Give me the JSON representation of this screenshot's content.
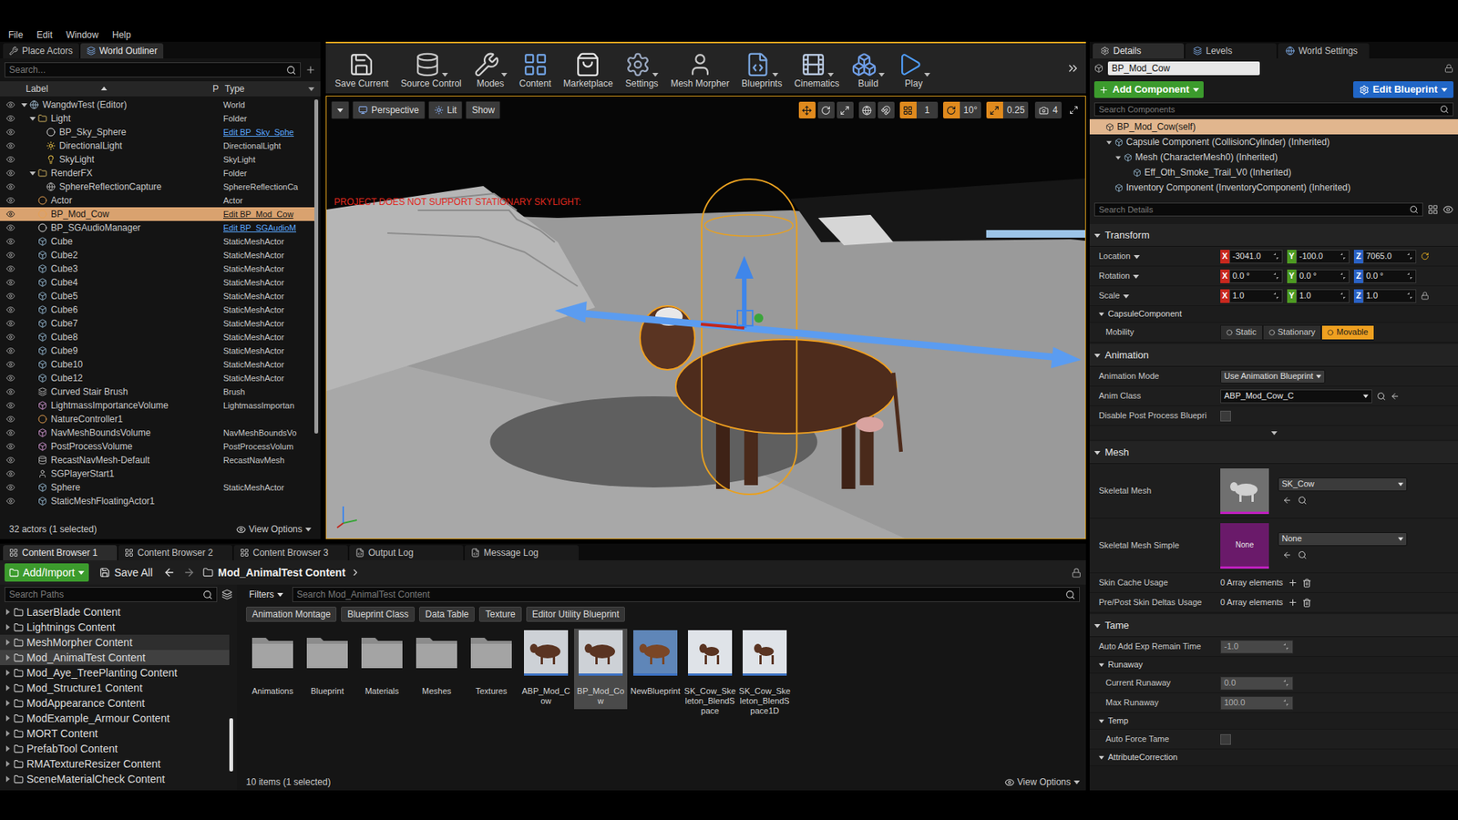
{
  "menu": [
    "File",
    "Edit",
    "Window",
    "Help"
  ],
  "outliner": {
    "tabs": [
      {
        "label": "Place Actors",
        "selected": false
      },
      {
        "label": "World Outliner",
        "selected": true
      }
    ],
    "search_placeholder": "Search...",
    "columns": {
      "label": "Label",
      "pinned": "P",
      "type": "Type"
    },
    "rows": [
      {
        "label": "WangdwTest (Editor)",
        "type": "World",
        "link": false,
        "kind": "world",
        "indent": 0,
        "expanded": true,
        "selected": false
      },
      {
        "label": "Light",
        "type": "Folder",
        "link": false,
        "kind": "folder",
        "indent": 1,
        "expanded": true,
        "selected": false
      },
      {
        "label": "BP_Sky_Sphere",
        "type": "Edit BP_Sky_Sphe",
        "link": true,
        "kind": "sky",
        "indent": 2,
        "expanded": false,
        "selected": false
      },
      {
        "label": "DirectionalLight",
        "type": "DirectionalLight",
        "link": false,
        "kind": "light",
        "indent": 2,
        "expanded": false,
        "selected": false
      },
      {
        "label": "SkyLight",
        "type": "SkyLight",
        "link": false,
        "kind": "skylight",
        "indent": 2,
        "expanded": false,
        "selected": false
      },
      {
        "label": "RenderFX",
        "type": "Folder",
        "link": false,
        "kind": "folder",
        "indent": 1,
        "expanded": true,
        "selected": false
      },
      {
        "label": "SphereReflectionCapture",
        "type": "SphereReflectionCa",
        "link": false,
        "kind": "reflection",
        "indent": 2,
        "expanded": false,
        "selected": false
      },
      {
        "label": "Actor",
        "type": "Actor",
        "link": false,
        "kind": "actor",
        "indent": 1,
        "expanded": false,
        "selected": false
      },
      {
        "label": "BP_Mod_Cow",
        "type": "Edit BP_Mod_Cow",
        "link": true,
        "kind": "actor",
        "indent": 1,
        "expanded": false,
        "selected": true
      },
      {
        "label": "BP_SGAudioManager",
        "type": "Edit BP_SGAudioM",
        "link": true,
        "kind": "sky",
        "indent": 1,
        "expanded": false,
        "selected": false
      },
      {
        "label": "Cube",
        "type": "StaticMeshActor",
        "link": false,
        "kind": "mesh",
        "indent": 1,
        "expanded": false,
        "selected": false
      },
      {
        "label": "Cube2",
        "type": "StaticMeshActor",
        "link": false,
        "kind": "mesh",
        "indent": 1,
        "expanded": false,
        "selected": false
      },
      {
        "label": "Cube3",
        "type": "StaticMeshActor",
        "link": false,
        "kind": "mesh",
        "indent": 1,
        "expanded": false,
        "selected": false
      },
      {
        "label": "Cube4",
        "type": "StaticMeshActor",
        "link": false,
        "kind": "mesh",
        "indent": 1,
        "expanded": false,
        "selected": false
      },
      {
        "label": "Cube5",
        "type": "StaticMeshActor",
        "link": false,
        "kind": "mesh",
        "indent": 1,
        "expanded": false,
        "selected": false
      },
      {
        "label": "Cube6",
        "type": "StaticMeshActor",
        "link": false,
        "kind": "mesh",
        "indent": 1,
        "expanded": false,
        "selected": false
      },
      {
        "label": "Cube7",
        "type": "StaticMeshActor",
        "link": false,
        "kind": "mesh",
        "indent": 1,
        "expanded": false,
        "selected": false
      },
      {
        "label": "Cube8",
        "type": "StaticMeshActor",
        "link": false,
        "kind": "mesh",
        "indent": 1,
        "expanded": false,
        "selected": false
      },
      {
        "label": "Cube9",
        "type": "StaticMeshActor",
        "link": false,
        "kind": "mesh",
        "indent": 1,
        "expanded": false,
        "selected": false
      },
      {
        "label": "Cube10",
        "type": "StaticMeshActor",
        "link": false,
        "kind": "mesh",
        "indent": 1,
        "expanded": false,
        "selected": false
      },
      {
        "label": "Cube12",
        "type": "StaticMeshActor",
        "link": false,
        "kind": "mesh",
        "indent": 1,
        "expanded": false,
        "selected": false
      },
      {
        "label": "Curved Stair Brush",
        "type": "Brush",
        "link": false,
        "kind": "brush",
        "indent": 1,
        "expanded": false,
        "selected": false
      },
      {
        "label": "LightmassImportanceVolume",
        "type": "LightmassImportan",
        "link": false,
        "kind": "volume",
        "indent": 1,
        "expanded": false,
        "selected": false
      },
      {
        "label": "NatureController1",
        "type": "",
        "link": false,
        "kind": "actor",
        "indent": 1,
        "expanded": false,
        "selected": false
      },
      {
        "label": "NavMeshBoundsVolume",
        "type": "NavMeshBoundsVo",
        "link": false,
        "kind": "volume",
        "indent": 1,
        "expanded": false,
        "selected": false
      },
      {
        "label": "PostProcessVolume",
        "type": "PostProcessVolum",
        "link": false,
        "kind": "volume",
        "indent": 1,
        "expanded": false,
        "selected": false
      },
      {
        "label": "RecastNavMesh-Default",
        "type": "RecastNavMesh",
        "link": false,
        "kind": "navmesh",
        "indent": 1,
        "expanded": false,
        "selected": false
      },
      {
        "label": "SGPlayerStart1",
        "type": "",
        "link": false,
        "kind": "start",
        "indent": 1,
        "expanded": false,
        "selected": false
      },
      {
        "label": "Sphere",
        "type": "StaticMeshActor",
        "link": false,
        "kind": "mesh",
        "indent": 1,
        "expanded": false,
        "selected": false
      },
      {
        "label": "StaticMeshFloatingActor1",
        "type": "",
        "link": false,
        "kind": "mesh",
        "indent": 1,
        "expanded": false,
        "selected": false
      }
    ],
    "status": "32 actors (1 selected)",
    "view_options": "View Options"
  },
  "toolbar": [
    {
      "label": "Save Current",
      "dropdown": false
    },
    {
      "label": "Source Control",
      "dropdown": true
    },
    {
      "label": "Modes",
      "dropdown": true
    },
    {
      "label": "Content",
      "dropdown": false
    },
    {
      "label": "Marketplace",
      "dropdown": false
    },
    {
      "label": "Settings",
      "dropdown": true
    },
    {
      "label": "Mesh Morpher",
      "dropdown": false
    },
    {
      "label": "Blueprints",
      "dropdown": true
    },
    {
      "label": "Cinematics",
      "dropdown": true
    },
    {
      "label": "Build",
      "dropdown": true
    },
    {
      "label": "Play",
      "dropdown": true
    }
  ],
  "viewport": {
    "view_mode": "Perspective",
    "lighting": "Lit",
    "show": "Show",
    "transform_tools": [
      {
        "selected": true
      },
      {
        "selected": false
      },
      {
        "selected": false
      }
    ],
    "snaps": [
      {
        "value": "1",
        "active": true
      },
      {
        "value": "10°",
        "active": true
      },
      {
        "value": "0.25",
        "active": true
      }
    ],
    "camera_speed": "4",
    "warning": "PROJECT DOES NOT SUPPORT STATIONARY SKYLIGHT:"
  },
  "details": {
    "tabs": [
      {
        "label": "Details",
        "selected": true
      },
      {
        "label": "Levels",
        "selected": false
      },
      {
        "label": "World Settings",
        "selected": false
      }
    ],
    "name": "BP_Mod_Cow",
    "add_component": "Add Component",
    "edit_blueprint": "Edit Blueprint",
    "search_components": "Search Components",
    "components": [
      {
        "label": "BP_Mod_Cow(self)",
        "depth": 0,
        "expanded": false,
        "selected": true
      },
      {
        "label": "Capsule Component (CollisionCylinder) (Inherited)",
        "depth": 1,
        "expanded": true,
        "selected": false
      },
      {
        "label": "Mesh (CharacterMesh0) (Inherited)",
        "depth": 2,
        "expanded": true,
        "selected": false
      },
      {
        "label": "Eff_Oth_Smoke_Trail_V0 (Inherited)",
        "depth": 3,
        "expanded": false,
        "selected": false
      },
      {
        "label": "Inventory Component (InventoryComponent) (Inherited)",
        "depth": 1,
        "expanded": false,
        "selected": false
      }
    ],
    "search_details": "Search Details",
    "axes": [
      "X",
      "Y",
      "Z"
    ],
    "properties": [
      {
        "kind": "category",
        "label": "Transform",
        "expanded": true
      },
      {
        "kind": "vector",
        "label": "Location",
        "depth": 0,
        "values": [
          "-3041.0",
          "-100.0",
          "7065.0"
        ],
        "reset": true,
        "lock": false
      },
      {
        "kind": "vector",
        "label": "Rotation",
        "depth": 0,
        "values": [
          "0.0 °",
          "0.0 °",
          "0.0 °"
        ],
        "reset": false,
        "lock": false
      },
      {
        "kind": "vector",
        "label": "Scale",
        "depth": 0,
        "values": [
          "1.0",
          "1.0",
          "1.0"
        ],
        "reset": false,
        "lock": true
      },
      {
        "kind": "subcategory",
        "label": "CapsuleComponent",
        "expanded": true
      },
      {
        "kind": "mobility",
        "label": "Mobility",
        "depth": 1,
        "options": [
          {
            "label": "Static",
            "selected": false
          },
          {
            "label": "Stationary",
            "selected": false
          },
          {
            "label": "Movable",
            "selected": true
          }
        ]
      },
      {
        "kind": "category",
        "label": "Animation",
        "expanded": true
      },
      {
        "kind": "enum",
        "label": "Animation Mode",
        "depth": 0,
        "value": "Use Animation Blueprint"
      },
      {
        "kind": "class",
        "label": "Anim Class",
        "depth": 0,
        "value": "ABP_Mod_Cow_C"
      },
      {
        "kind": "checkbox",
        "label": "Disable Post Process Bluepri",
        "depth": 0,
        "checked": false
      },
      {
        "kind": "advanced",
        "expanded": false
      },
      {
        "kind": "category",
        "label": "Mesh",
        "expanded": true
      },
      {
        "kind": "asset",
        "label": "Skeletal Mesh",
        "depth": 0,
        "value": "SK_Cow",
        "empty": false
      },
      {
        "kind": "asset",
        "label": "Skeletal Mesh Simple",
        "depth": 0,
        "value": "None",
        "empty": true,
        "thumbnail_text": "None"
      },
      {
        "kind": "array",
        "label": "Skin Cache Usage",
        "depth": 0,
        "value": "0 Array elements"
      },
      {
        "kind": "array",
        "label": "Pre/Post Skin Deltas Usage",
        "depth": 0,
        "value": "0 Array elements"
      },
      {
        "kind": "category",
        "label": "Tame",
        "expanded": true
      },
      {
        "kind": "number",
        "label": "Auto Add Exp Remain Time",
        "depth": 0,
        "value": "-1.0",
        "disabled": true
      },
      {
        "kind": "subcategory",
        "label": "Runaway",
        "expanded": true
      },
      {
        "kind": "number",
        "label": "Current Runaway",
        "depth": 1,
        "value": "0.0",
        "disabled": true
      },
      {
        "kind": "number",
        "label": "Max Runaway",
        "depth": 1,
        "value": "100.0",
        "disabled": true
      },
      {
        "kind": "subcategory",
        "label": "Temp",
        "expanded": true
      },
      {
        "kind": "checkbox",
        "label": "Auto Force Tame",
        "depth": 1,
        "checked": false
      },
      {
        "kind": "subcategory",
        "label": "AttributeCorrection",
        "expanded": true
      }
    ]
  },
  "content_browser": {
    "tabs": [
      {
        "label": "Content Browser 1",
        "selected": true
      },
      {
        "label": "Content Browser 2",
        "selected": false
      },
      {
        "label": "Content Browser 3",
        "selected": false
      },
      {
        "label": "Output Log",
        "selected": false
      },
      {
        "label": "Message Log",
        "selected": false
      }
    ],
    "add_import": "Add/Import",
    "save_all": "Save All",
    "path": "Mod_AnimalTest Content",
    "paths_search": "Search Paths",
    "folders": [
      {
        "label": "LaserBlade Content",
        "selected": false,
        "hovered": false
      },
      {
        "label": "Lightnings Content",
        "selected": false,
        "hovered": false
      },
      {
        "label": "MeshMorpher Content",
        "selected": false,
        "hovered": true
      },
      {
        "label": "Mod_AnimalTest Content",
        "selected": true,
        "hovered": false
      },
      {
        "label": "Mod_Aye_TreePlanting Content",
        "selected": false,
        "hovered": false
      },
      {
        "label": "Mod_Structure1 Content",
        "selected": false,
        "hovered": false
      },
      {
        "label": "ModAppearance Content",
        "selected": false,
        "hovered": false
      },
      {
        "label": "ModExample_Armour Content",
        "selected": false,
        "hovered": false
      },
      {
        "label": "MORT Content",
        "selected": false,
        "hovered": false
      },
      {
        "label": "PrefabTool Content",
        "selected": false,
        "hovered": false
      },
      {
        "label": "RMATextureResizer Content",
        "selected": false,
        "hovered": false
      },
      {
        "label": "SceneMaterialCheck Content",
        "selected": false,
        "hovered": false
      }
    ],
    "filters": "Filters",
    "search": "Search Mod_AnimalTest Content",
    "filter_chips": [
      "Animation Montage",
      "Blueprint Class",
      "Data Table",
      "Texture",
      "Editor Utility Blueprint"
    ],
    "assets": [
      {
        "label": "Animations",
        "kind": "folder",
        "selected": false
      },
      {
        "label": "Blueprint",
        "kind": "folder",
        "selected": false
      },
      {
        "label": "Materials",
        "kind": "folder",
        "selected": false
      },
      {
        "label": "Meshes",
        "kind": "folder",
        "selected": false
      },
      {
        "label": "Textures",
        "kind": "folder",
        "selected": false
      },
      {
        "label": "ABP_Mod_Cow",
        "kind": "anim_blueprint",
        "selected": false
      },
      {
        "label": "BP_Mod_Cow",
        "kind": "blueprint",
        "selected": true
      },
      {
        "label": "NewBlueprint",
        "kind": "horse_blueprint",
        "selected": false
      },
      {
        "label": "SK_Cow_Skeleton_BlendSpace",
        "kind": "blendspace",
        "selected": false
      },
      {
        "label": "SK_Cow_Skeleton_BlendSpace1D",
        "kind": "blendspace",
        "selected": false
      }
    ],
    "status": "10 items (1 selected)",
    "view_options": "View Options"
  }
}
